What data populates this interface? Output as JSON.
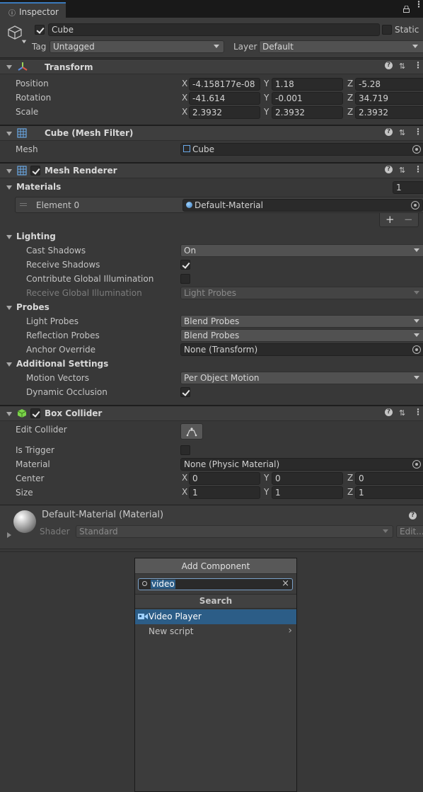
{
  "window": {
    "tab_title": "Inspector"
  },
  "header": {
    "object_name": "Cube",
    "static_label": "Static",
    "tag_label": "Tag",
    "tag_value": "Untagged",
    "layer_label": "Layer",
    "layer_value": "Default"
  },
  "transform": {
    "title": "Transform",
    "rows": [
      {
        "label": "Position",
        "x": "-4.158177e-08",
        "y": "1.18",
        "z": "-5.28"
      },
      {
        "label": "Rotation",
        "x": "-41.614",
        "y": "-0.001",
        "z": "34.719"
      },
      {
        "label": "Scale",
        "x": "2.3932",
        "y": "2.3932",
        "z": "2.3932"
      }
    ],
    "axes": {
      "x": "X",
      "y": "Y",
      "z": "Z"
    }
  },
  "mesh_filter": {
    "title": "Cube (Mesh Filter)",
    "mesh_label": "Mesh",
    "mesh_value": "Cube"
  },
  "mesh_renderer": {
    "title": "Mesh Renderer",
    "materials_label": "Materials",
    "materials_count": "1",
    "element_label": "Element 0",
    "element_value": "Default-Material",
    "add_symbol": "+",
    "remove_symbol": "−",
    "lighting": {
      "title": "Lighting",
      "cast_shadows_label": "Cast Shadows",
      "cast_shadows_value": "On",
      "receive_shadows_label": "Receive Shadows",
      "contribute_gi_label": "Contribute Global Illumination",
      "receive_gi_label": "Receive Global Illumination",
      "receive_gi_value": "Light Probes"
    },
    "probes": {
      "title": "Probes",
      "light_probes_label": "Light Probes",
      "light_probes_value": "Blend Probes",
      "reflection_probes_label": "Reflection Probes",
      "reflection_probes_value": "Blend Probes",
      "anchor_label": "Anchor Override",
      "anchor_value": "None (Transform)"
    },
    "additional": {
      "title": "Additional Settings",
      "motion_vectors_label": "Motion Vectors",
      "motion_vectors_value": "Per Object Motion",
      "dynamic_occlusion_label": "Dynamic Occlusion"
    }
  },
  "box_collider": {
    "title": "Box Collider",
    "edit_label": "Edit Collider",
    "trigger_label": "Is Trigger",
    "material_label": "Material",
    "material_value": "None (Physic Material)",
    "center_label": "Center",
    "center": {
      "x": "0",
      "y": "0",
      "z": "0"
    },
    "size_label": "Size",
    "size": {
      "x": "1",
      "y": "1",
      "z": "1"
    }
  },
  "material": {
    "title": "Default-Material (Material)",
    "shader_label": "Shader",
    "shader_value": "Standard",
    "edit_label": "Edit..."
  },
  "add_component": {
    "button_label": "Add Component",
    "search_value": "video",
    "search_heading": "Search",
    "results": [
      "Video Player",
      "New script"
    ]
  },
  "colors": {
    "accent": "#3a79bb",
    "selection": "#2c5d87",
    "background": "#383838"
  }
}
